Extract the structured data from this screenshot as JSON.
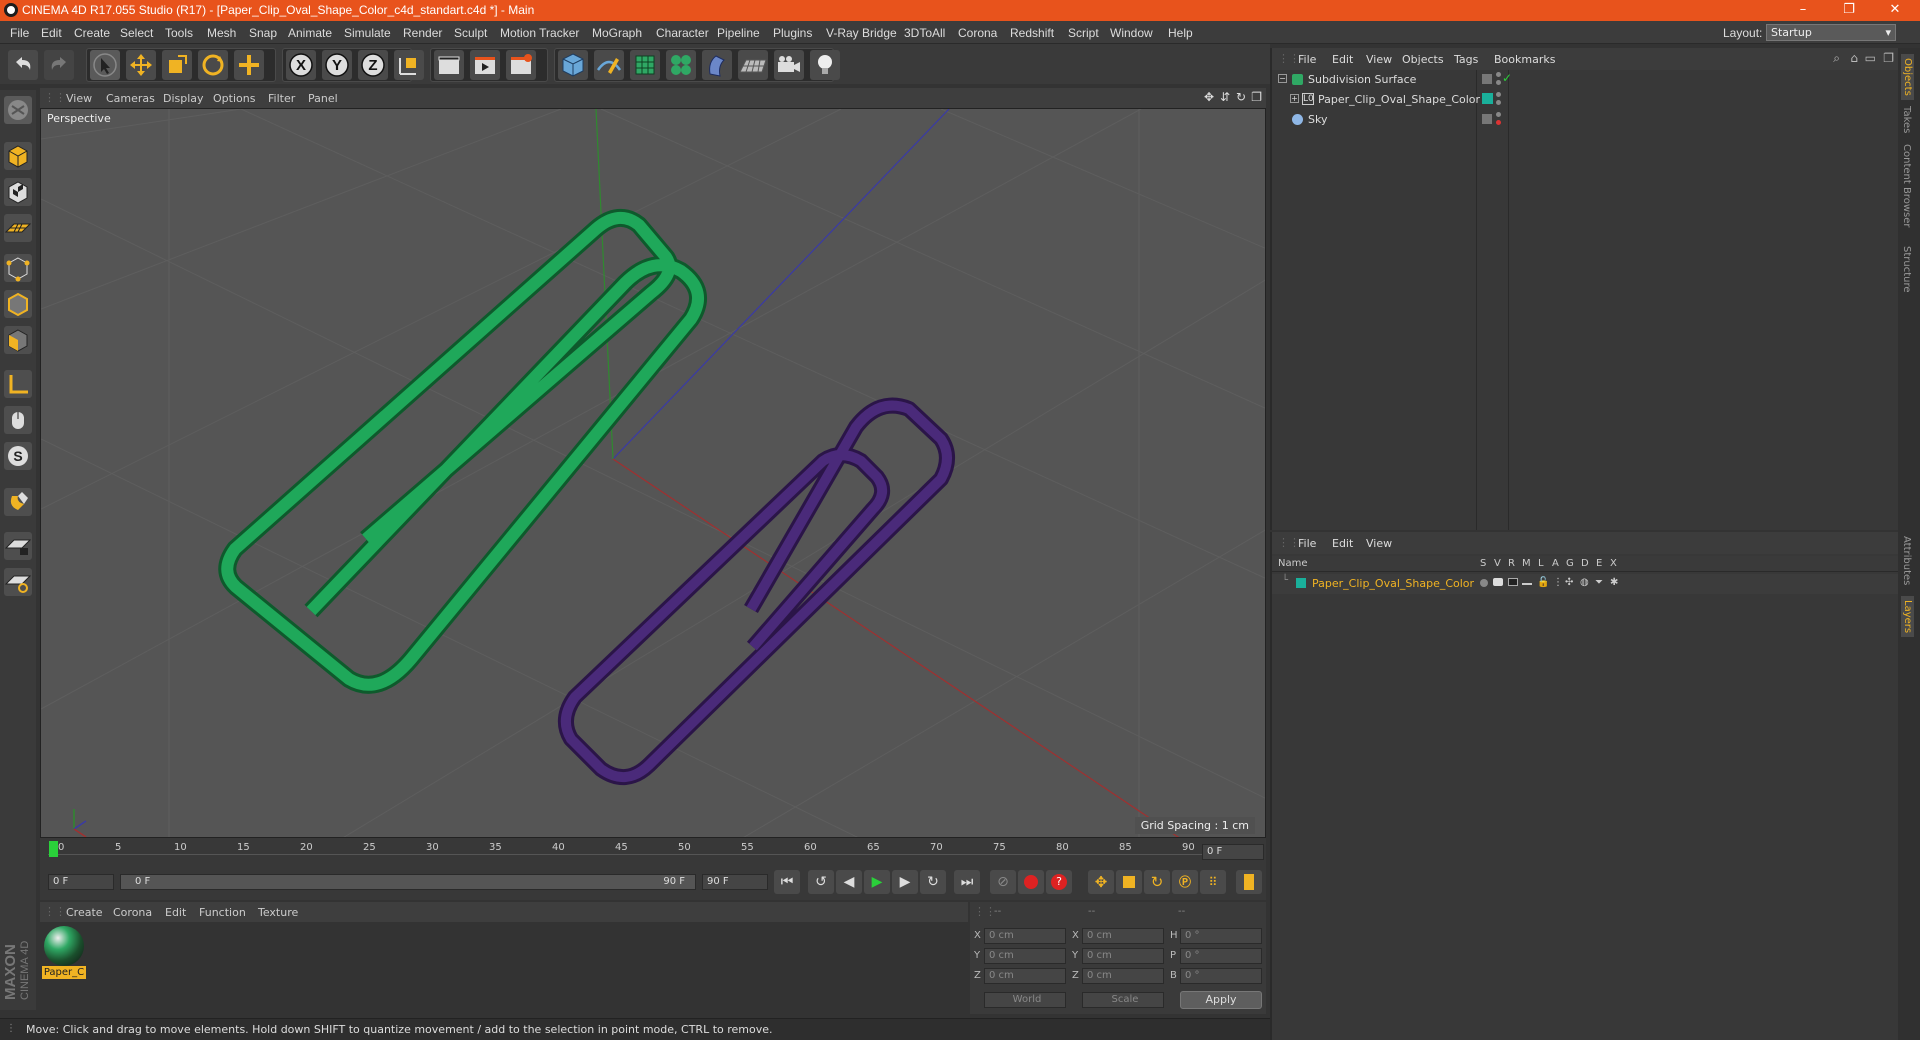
{
  "window": {
    "title": "CINEMA 4D R17.055 Studio (R17) - [Paper_Clip_Oval_Shape_Color_c4d_standart.c4d *] - Main",
    "min": "–",
    "max": "❐",
    "close": "✕"
  },
  "menubar": {
    "items": [
      "File",
      "Edit",
      "Create",
      "Select",
      "Tools",
      "Mesh",
      "Snap",
      "Animate",
      "Simulate",
      "Render",
      "Sculpt",
      "Motion Tracker",
      "MoGraph",
      "Character",
      "Pipeline",
      "Plugins",
      "V-Ray Bridge",
      "3DToAll",
      "Corona",
      "Redshift",
      "Script",
      "Window",
      "Help"
    ],
    "layout_label": "Layout:",
    "layout_value": "Startup"
  },
  "toolbar": {
    "axis_x": "X",
    "axis_y": "Y",
    "axis_z": "Z"
  },
  "viewport": {
    "menu": [
      "View",
      "Cameras",
      "Display",
      "Options",
      "Filter",
      "Panel"
    ],
    "label": "Perspective",
    "grid_spacing": "Grid Spacing : 1 cm",
    "colors": {
      "clip_green": "#1fa85a",
      "clip_purple": "#4a2a7a",
      "background": "#555555"
    }
  },
  "timeline": {
    "ticks": [
      "0",
      "5",
      "10",
      "15",
      "20",
      "25",
      "30",
      "35",
      "40",
      "45",
      "50",
      "55",
      "60",
      "65",
      "70",
      "75",
      "80",
      "85",
      "90"
    ],
    "current_frame": "0 F",
    "start_field": "0 F",
    "range_start": "0 F",
    "range_end": "90 F",
    "end_field": "90 F"
  },
  "materials": {
    "menu": [
      "Create",
      "Corona",
      "Edit",
      "Function",
      "Texture"
    ],
    "swatch_label": "Paper_C"
  },
  "coordinates": {
    "header": [
      "--",
      "--",
      "--"
    ],
    "rows": [
      {
        "a": "X",
        "av": "0 cm",
        "b": "X",
        "bv": "0 cm",
        "c": "H",
        "cv": "0 °"
      },
      {
        "a": "Y",
        "av": "0 cm",
        "b": "Y",
        "bv": "0 cm",
        "c": "P",
        "cv": "0 °"
      },
      {
        "a": "Z",
        "av": "0 cm",
        "b": "Z",
        "bv": "0 cm",
        "c": "B",
        "cv": "0 °"
      }
    ],
    "mode1": "World",
    "mode2": "Scale",
    "apply": "Apply"
  },
  "status": "Move: Click and drag to move elements. Hold down SHIFT to quantize movement / add to the selection in point mode, CTRL to remove.",
  "objects": {
    "menu": [
      "File",
      "Edit",
      "View",
      "Objects",
      "Tags",
      "Bookmarks"
    ],
    "items": [
      {
        "name": "Subdivision Surface"
      },
      {
        "name": "Paper_Clip_Oval_Shape_Color"
      },
      {
        "name": "Sky"
      }
    ]
  },
  "layers": {
    "menu": [
      "File",
      "Edit",
      "View"
    ],
    "columns": [
      "Name",
      "S",
      "V",
      "R",
      "M",
      "L",
      "A",
      "G",
      "D",
      "E",
      "X"
    ],
    "items": [
      {
        "name": "Paper_Clip_Oval_Shape_Color",
        "color": "#1ab09b"
      }
    ]
  },
  "right_tabs": [
    "Objects",
    "Takes",
    "Content Browser",
    "Structure",
    "Attributes",
    "Layers"
  ],
  "brand": {
    "line1": "MAXON",
    "line2": "CINEMA 4D"
  }
}
